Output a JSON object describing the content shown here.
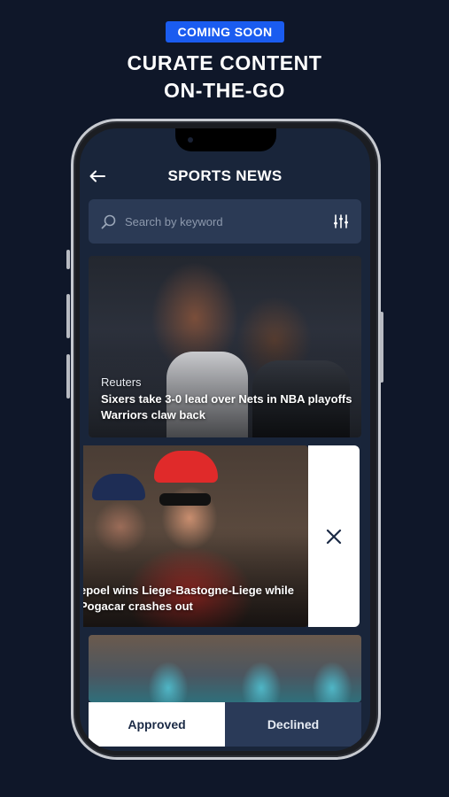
{
  "promo": {
    "badge": "COMING SOON",
    "headline_line1": "CURATE CONTENT",
    "headline_line2": "ON-THE-GO"
  },
  "app": {
    "title": "SPORTS NEWS",
    "search_placeholder": "Search by keyword"
  },
  "cards": [
    {
      "source": "Reuters",
      "title": "Sixers take 3-0 lead over Nets in NBA playoffs Warriors claw back"
    },
    {
      "title": "epoel wins Liege-Bastogne-Liege while Pogacar crashes out"
    }
  ],
  "tabs": {
    "approved": "Approved",
    "declined": "Declined"
  },
  "colors": {
    "background": "#0f1729",
    "accent": "#1a5cf0",
    "screen": "#19253a"
  }
}
